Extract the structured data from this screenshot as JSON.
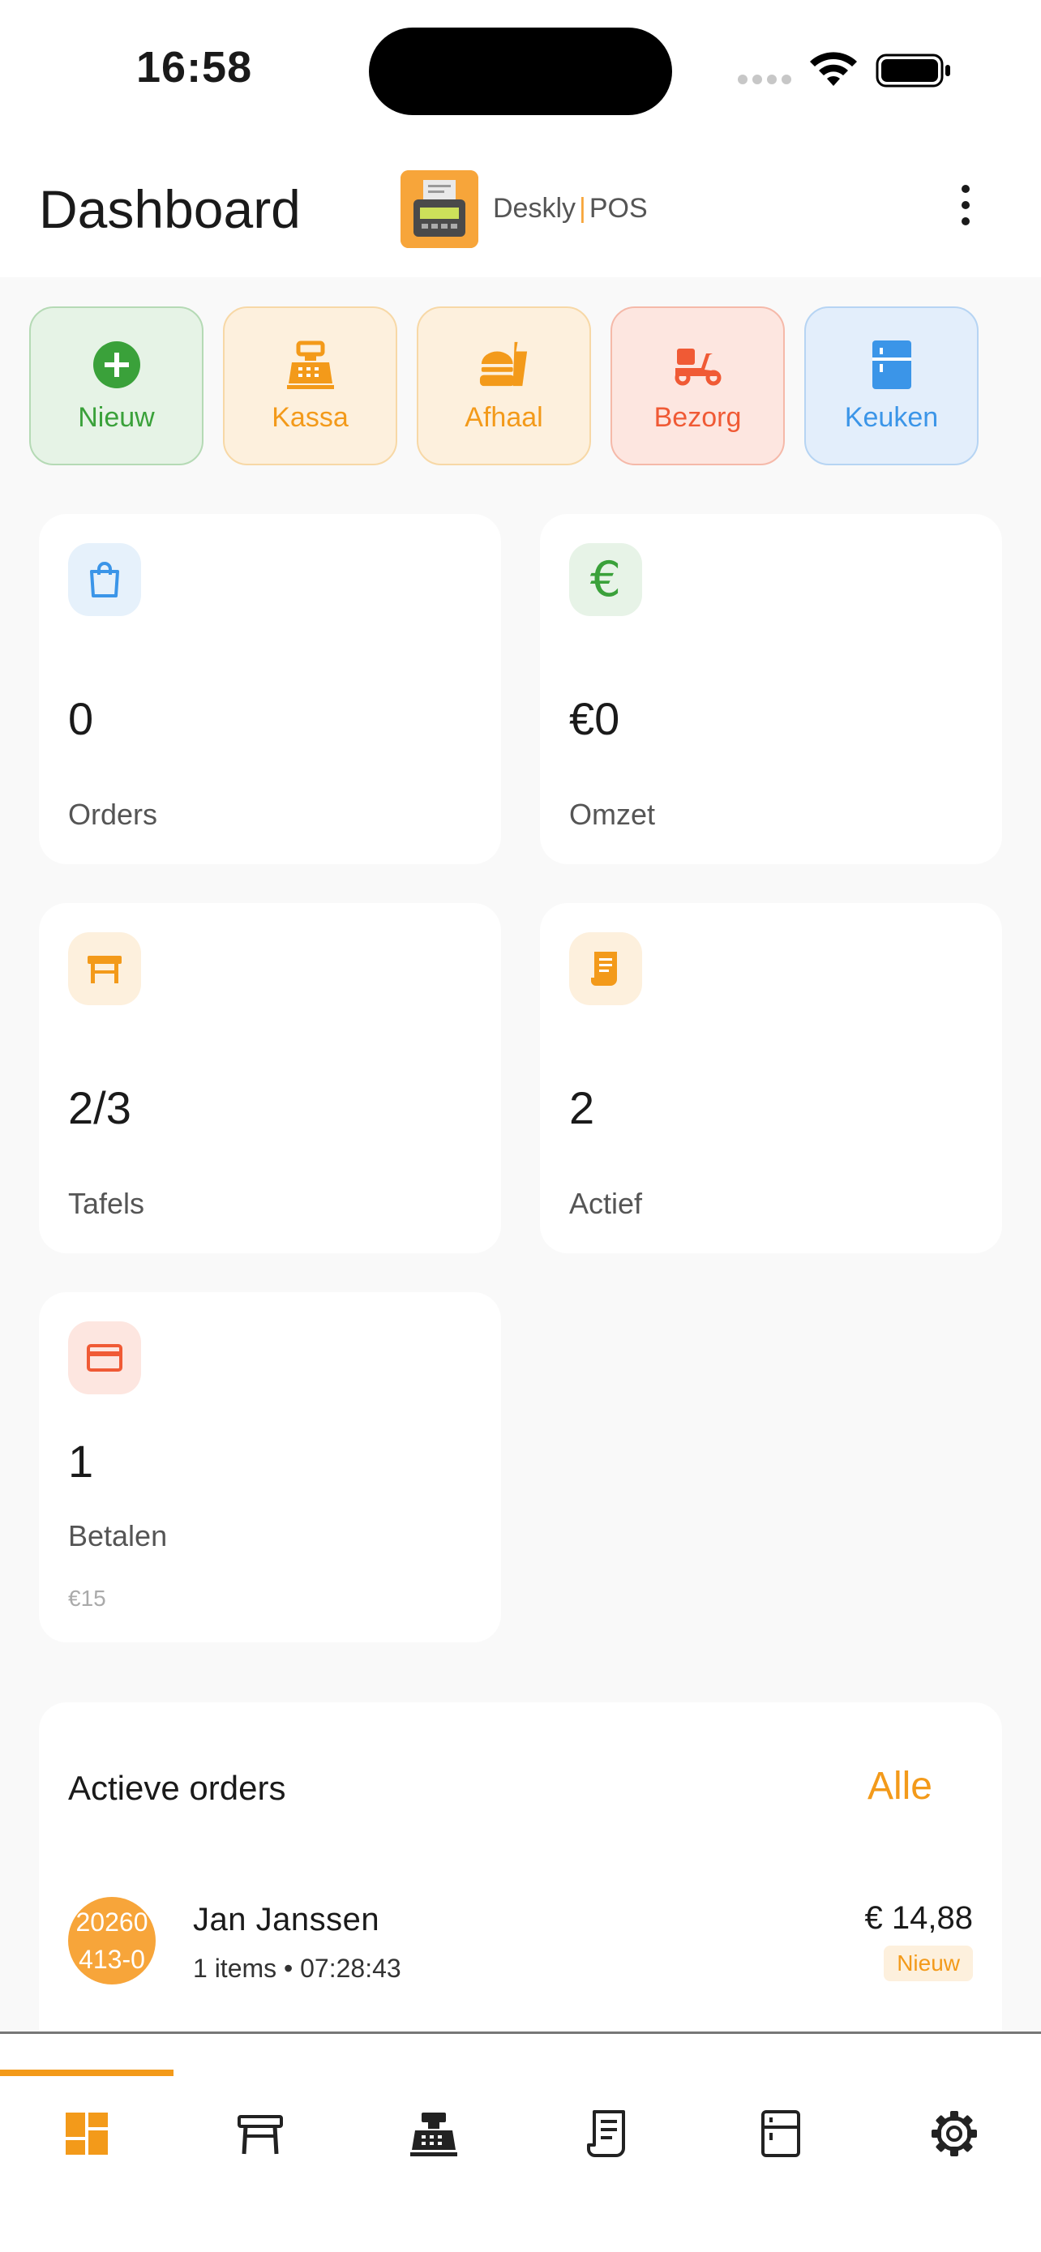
{
  "status_bar": {
    "time": "16:58"
  },
  "header": {
    "title": "Dashboard",
    "brand_name": "Deskly",
    "brand_separator": "|",
    "brand_suffix": "POS"
  },
  "quick_actions": [
    {
      "label": "Nieuw",
      "icon": "plus-circle-icon",
      "color": "#3aa13a"
    },
    {
      "label": "Kassa",
      "icon": "cash-register-icon",
      "color": "#f39a1a"
    },
    {
      "label": "Afhaal",
      "icon": "takeaway-food-icon",
      "color": "#f39a1a"
    },
    {
      "label": "Bezorg",
      "icon": "delivery-scooter-icon",
      "color": "#f05a35"
    },
    {
      "label": "Keuken",
      "icon": "kitchen-fridge-icon",
      "color": "#3b95e8"
    }
  ],
  "stats": {
    "orders": {
      "value": "0",
      "label": "Orders",
      "icon": "shopping-bag-icon"
    },
    "revenue": {
      "value": "€0",
      "label": "Omzet",
      "icon": "euro-icon"
    },
    "tables": {
      "value": "2/3",
      "label": "Tafels",
      "icon": "table-icon"
    },
    "active": {
      "value": "2",
      "label": "Actief",
      "icon": "receipt-icon"
    },
    "payments": {
      "value": "1",
      "label": "Betalen",
      "sub": "€15",
      "icon": "credit-card-icon"
    }
  },
  "active_orders": {
    "title": "Actieve orders",
    "all_label": "Alle",
    "items": [
      {
        "avatar_line1": "20260",
        "avatar_line2": "413-0",
        "name": "Jan Janssen",
        "meta": "1 items • 07:28:43",
        "price": "€ 14,88",
        "status": "Nieuw"
      }
    ]
  },
  "bottom_nav": [
    {
      "icon": "dashboard-icon",
      "active": true
    },
    {
      "icon": "table-icon",
      "active": false
    },
    {
      "icon": "cash-register-icon",
      "active": false
    },
    {
      "icon": "receipt-icon",
      "active": false
    },
    {
      "icon": "kitchen-fridge-icon",
      "active": false
    },
    {
      "icon": "settings-gear-icon",
      "active": false
    }
  ],
  "colors": {
    "accent": "#f39a1a",
    "green": "#3aa13a",
    "red": "#f05a35",
    "blue": "#3b95e8"
  }
}
